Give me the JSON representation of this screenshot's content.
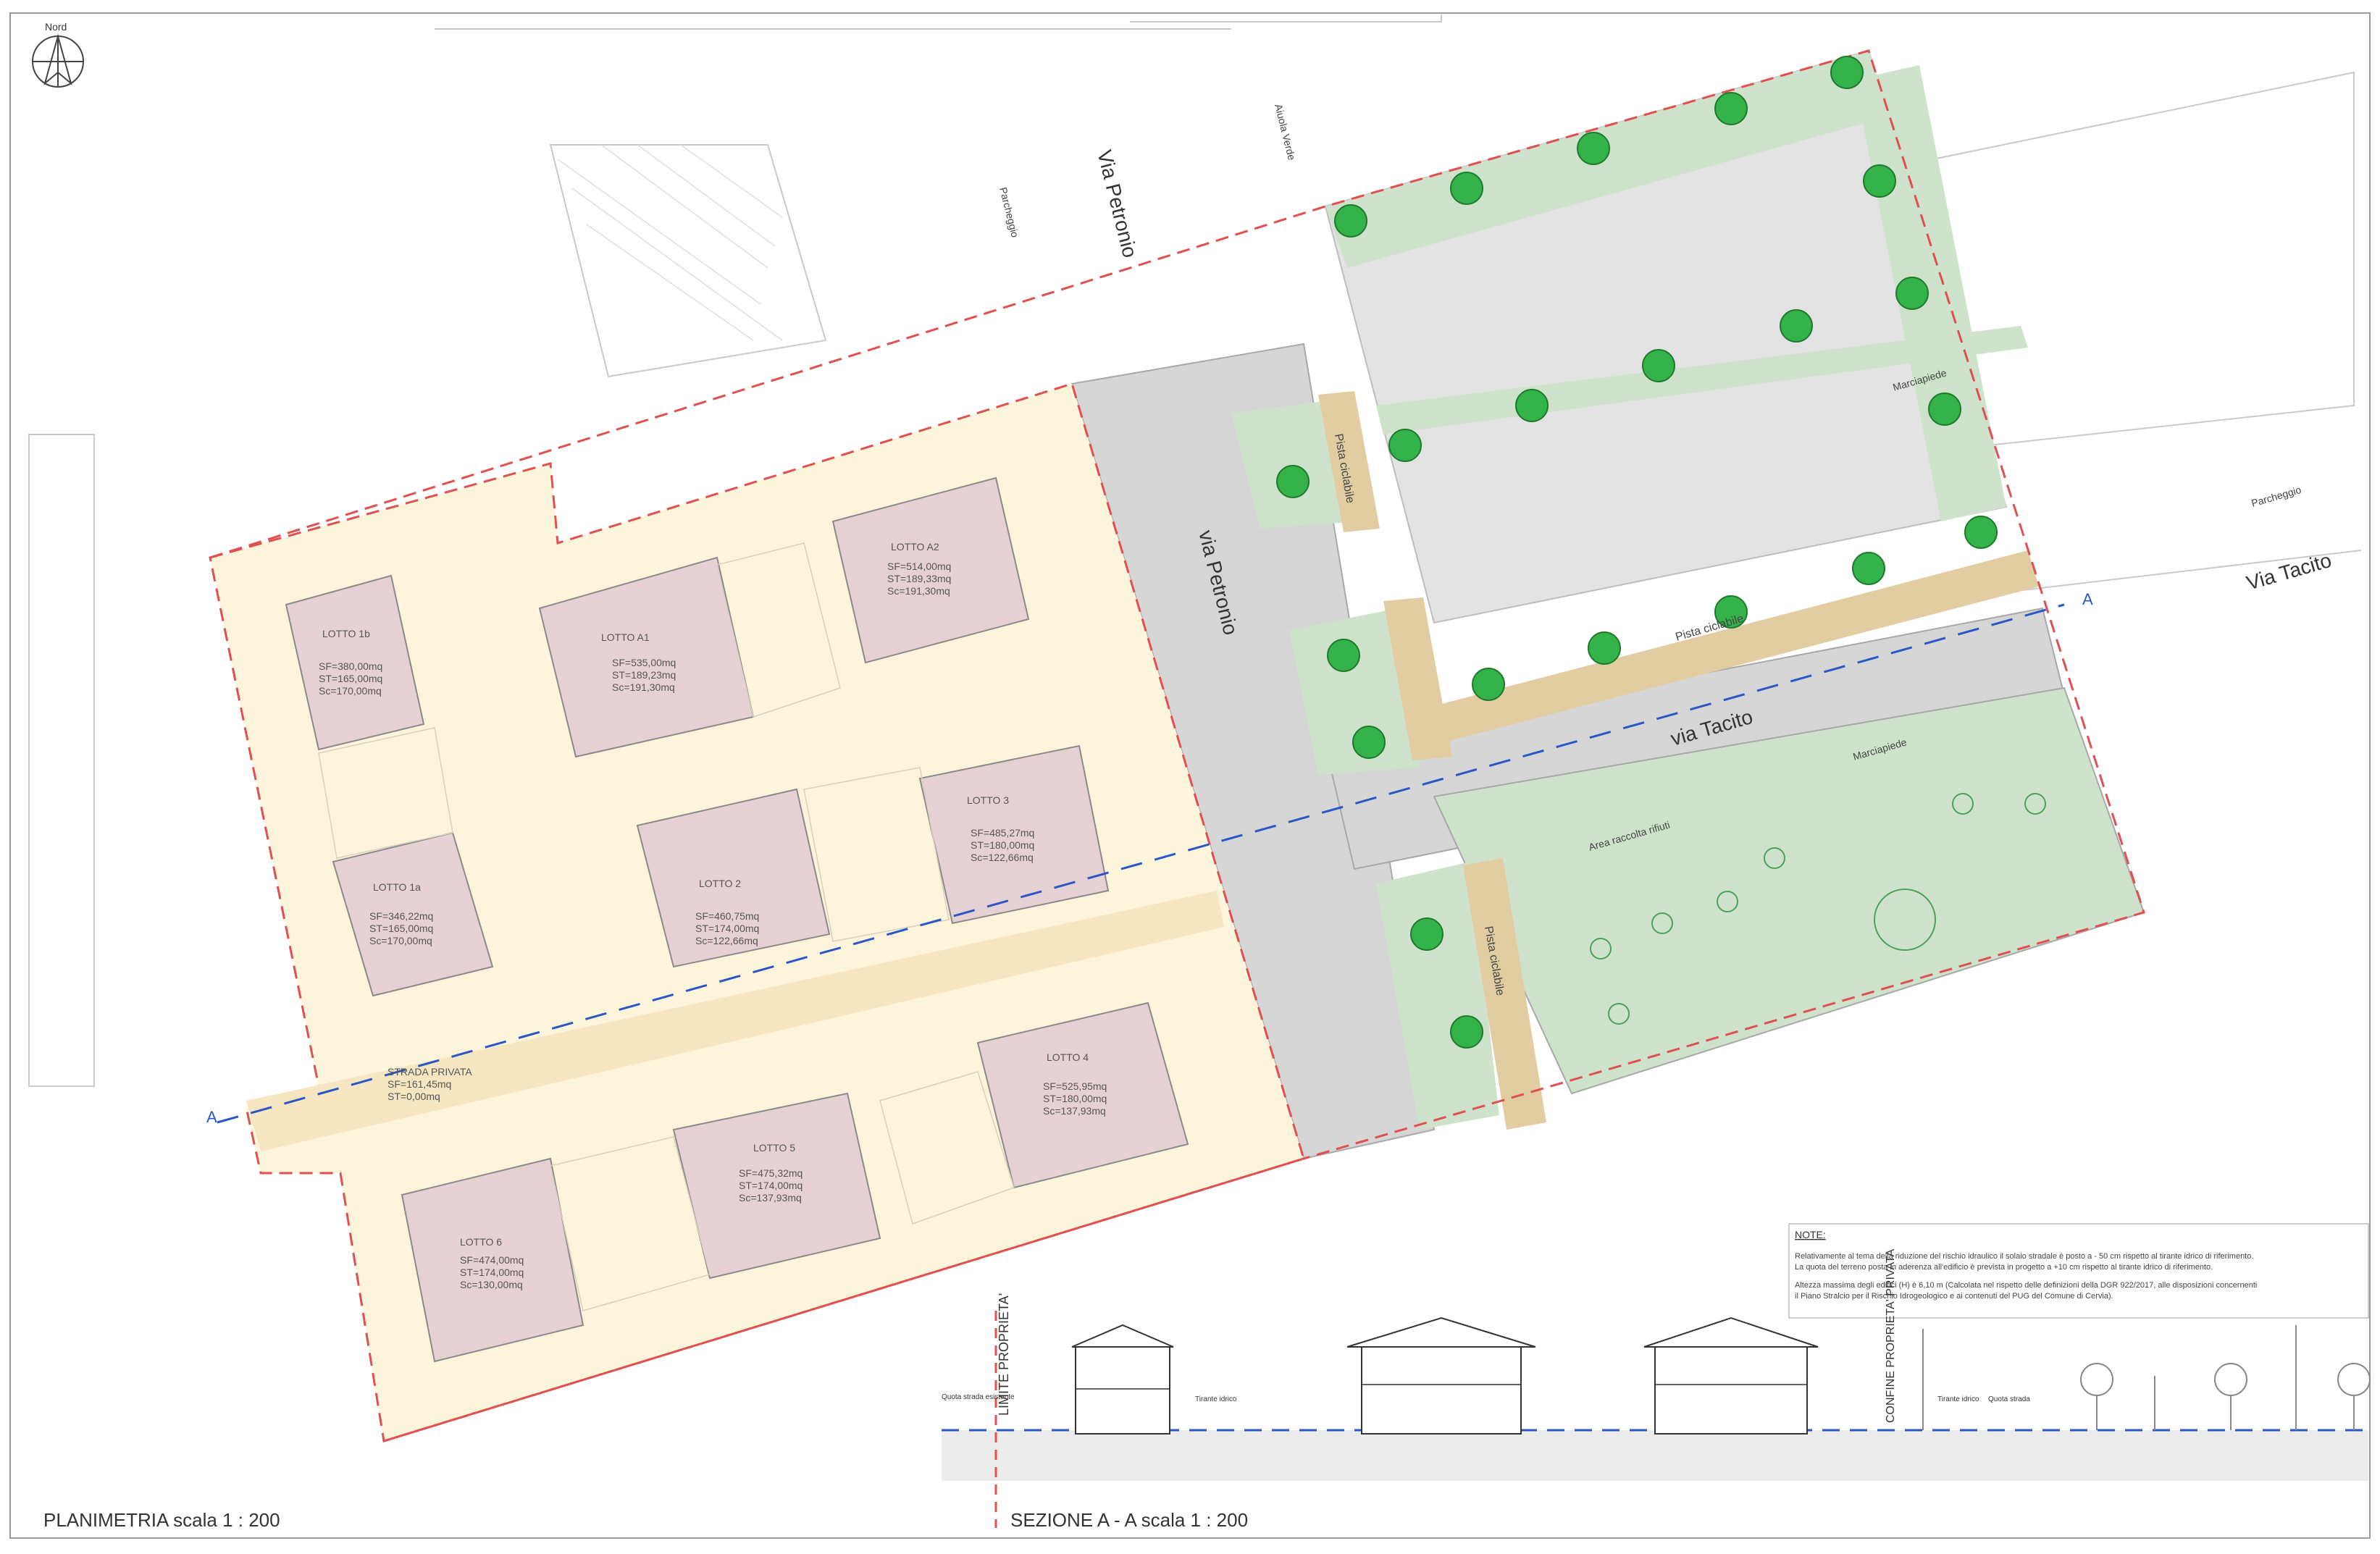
{
  "north_label": "Nord",
  "streets": {
    "petronio_top": "Via Petronio",
    "petronio_road": "via Petronio",
    "tacito_road": "via Tacito",
    "tacito_right": "Via Tacito",
    "marciapiede": "Marciapiede",
    "aiuola_verde": "Aiuola Verde",
    "parcheggio": "Parcheggio",
    "pista_ciclabile": "Pista ciclabile",
    "area_rifiuti": "Area raccolta rifiuti"
  },
  "lots": [
    {
      "name": "LOTTO 1b",
      "sf": "SF=380,00mq",
      "st": "ST=165,00mq",
      "sc": "Sc=170,00mq"
    },
    {
      "name": "LOTTO A1",
      "sf": "SF=535,00mq",
      "st": "ST=189,23mq",
      "sc": "Sc=191,30mq"
    },
    {
      "name": "LOTTO A2",
      "sf": "SF=514,00mq",
      "st": "ST=189,33mq",
      "sc": "Sc=191,30mq"
    },
    {
      "name": "LOTTO 1a",
      "sf": "SF=346,22mq",
      "st": "ST=165,00mq",
      "sc": "Sc=170,00mq"
    },
    {
      "name": "LOTTO 2",
      "sf": "SF=460,75mq",
      "st": "ST=174,00mq",
      "sc": "Sc=122,66mq"
    },
    {
      "name": "LOTTO 3",
      "sf": "SF=485,27mq",
      "st": "ST=180,00mq",
      "sc": "Sc=122,66mq"
    },
    {
      "name": "LOTTO 4",
      "sf": "SF=525,95mq",
      "st": "ST=180,00mq",
      "sc": "Sc=137,93mq"
    },
    {
      "name": "LOTTO 5",
      "sf": "SF=475,32mq",
      "st": "ST=174,00mq",
      "sc": "Sc=137,93mq"
    },
    {
      "name": "LOTTO 6",
      "sf": "SF=474,00mq",
      "st": "ST=174,00mq",
      "sc": "Sc=130,00mq"
    }
  ],
  "strada": {
    "name": "STRADA PRIVATA",
    "sf": "SF=161,45mq",
    "st": "ST=0,00mq"
  },
  "section_marker": "A",
  "notes": {
    "title": "NOTE:",
    "p1a": "Relativamente al tema della riduzione del rischio idraulico il solaio stradale è posto a - 50 cm rispetto al tirante idrico di riferimento.",
    "p1b": "La quota del terreno posta in aderenza all'edificio è prevista in progetto a +10 cm rispetto al tirante idrico di riferimento.",
    "p2a": "Altezza massima degli edifici (H) è 6,10 m (Calcolata nel rispetto delle definizioni della DGR 922/2017, alle disposizioni concernenti",
    "p2b": "il Piano Stralcio per il Rischio Idrogeologico e ai contenuti del PUG del Comune di Cervia)."
  },
  "section": {
    "limite": "LIMITE PROPRIETA'",
    "confine": "CONFINE PROPRIETA' PRIVATA",
    "quota_esistente": "Quota strada esistente",
    "tirante": "Tirante idrico",
    "quota_strada": "Quota strada"
  },
  "footer": {
    "planimetria": "PLANIMETRIA  scala   1 : 200",
    "sezione": "SEZIONE  A - A  scala   1 : 200"
  }
}
